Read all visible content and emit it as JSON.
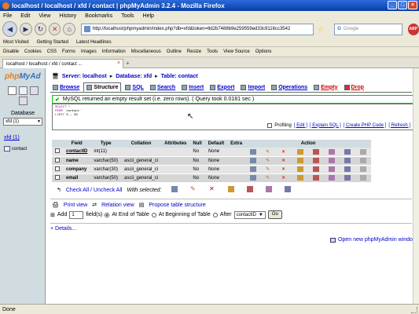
{
  "window": {
    "title": "localhost / localhost / xfd / contact | phpMyAdmin 3.2.4 - Mozilla Firefox"
  },
  "menu": [
    "File",
    "Edit",
    "View",
    "History",
    "Bookmarks",
    "Tools",
    "Help"
  ],
  "url": "http://localhost/phpmyadmin/index.php?db=xfd&token=8d2b7488b9e259559ed33c9116cc3542",
  "search": {
    "placeholder": "Google"
  },
  "bookmarks": [
    "Most Visited",
    "Getting Started",
    "Latest Headlines"
  ],
  "webdev": [
    "Disable",
    "Cookies",
    "CSS",
    "Forms",
    "Images",
    "Information",
    "Miscellaneous",
    "Outline",
    "Resize",
    "Tools",
    "View Source",
    "Options"
  ],
  "tab": {
    "label": "localhost / localhost / xfd / contact ..."
  },
  "sidebar": {
    "logo_a": "php",
    "logo_b": "MyAd",
    "db_label": "Database",
    "db_select": "xfd (1)",
    "db_name": "xfd (1)",
    "table_item": "contact"
  },
  "breadcrumb": {
    "server": "Server: localhost",
    "database": "Database: xfd",
    "table": "Table: contact"
  },
  "pma_tabs": [
    "Browse",
    "Structure",
    "SQL",
    "Search",
    "Insert",
    "Export",
    "Import",
    "Operations",
    "Empty",
    "Drop"
  ],
  "message": "MySQL returned an empty result set (i.e. zero rows). ( Query took 0.0181 sec )",
  "sql": {
    "line1a": "SELECT",
    "line1b": "*",
    "line2a": "FROM",
    "line2b": "`contact`",
    "line3a": "LIMIT",
    "line3b": "0 , 30",
    "profiling": "Profiling",
    "edit": "[ Edit ]",
    "explain": "[ Explain SQL ]",
    "create_php": "[ Create PHP Code ]",
    "refresh": "[ Refresh ]"
  },
  "table": {
    "headers": [
      "",
      "Field",
      "Type",
      "Collation",
      "Attributes",
      "Null",
      "Default",
      "Extra",
      "Action"
    ],
    "rows": [
      {
        "field": "contactID",
        "type": "int(11)",
        "collation": "",
        "attributes": "",
        "null": "No",
        "default": "None",
        "extra": ""
      },
      {
        "field": "name",
        "type": "varchar(50)",
        "collation": "ascii_general_ci",
        "attributes": "",
        "null": "No",
        "default": "None",
        "extra": ""
      },
      {
        "field": "company",
        "type": "varchar(30)",
        "collation": "ascii_general_ci",
        "attributes": "",
        "null": "No",
        "default": "None",
        "extra": ""
      },
      {
        "field": "email",
        "type": "varchar(50)",
        "collation": "ascii_general_ci",
        "attributes": "",
        "null": "No",
        "default": "None",
        "extra": ""
      }
    ]
  },
  "bulk": {
    "check_all": "Check All / Uncheck All",
    "with_selected": "With selected:"
  },
  "tools": {
    "print_view": "Print view",
    "relation_view": "Relation view",
    "propose": "Propose table structure"
  },
  "add": {
    "label": "Add",
    "count": "1",
    "fields": "field(s)",
    "end": "At End of Table",
    "beginning": "At Beginning of Table",
    "after": "After",
    "after_select": "contactID",
    "go": "Go"
  },
  "details": "+ Details...",
  "open_window": "Open new phpMyAdmin window",
  "status": "Done"
}
